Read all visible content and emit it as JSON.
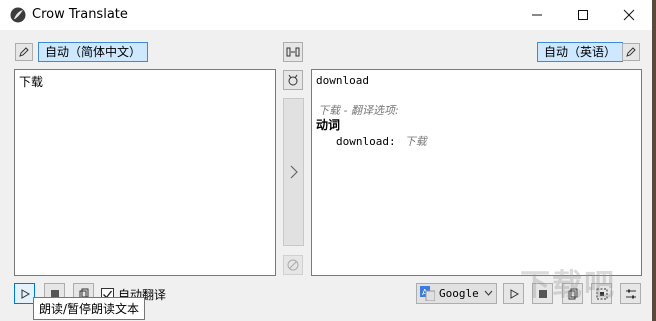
{
  "window": {
    "title": "Crow Translate"
  },
  "source": {
    "language": "自动（简体中文）",
    "text": "下载",
    "auto_translate_label": "自动翻译"
  },
  "target": {
    "language": "自动（英语）",
    "text_main": "download",
    "options_header": "下载 - 翻译选项:",
    "pos": "动词",
    "entry_word": "download:",
    "entry_translation": "下载"
  },
  "engine": {
    "selected": "Google"
  },
  "tooltip": {
    "text": "朗读/暂停朗读文本"
  },
  "watermark": {
    "text": "下载吧"
  }
}
